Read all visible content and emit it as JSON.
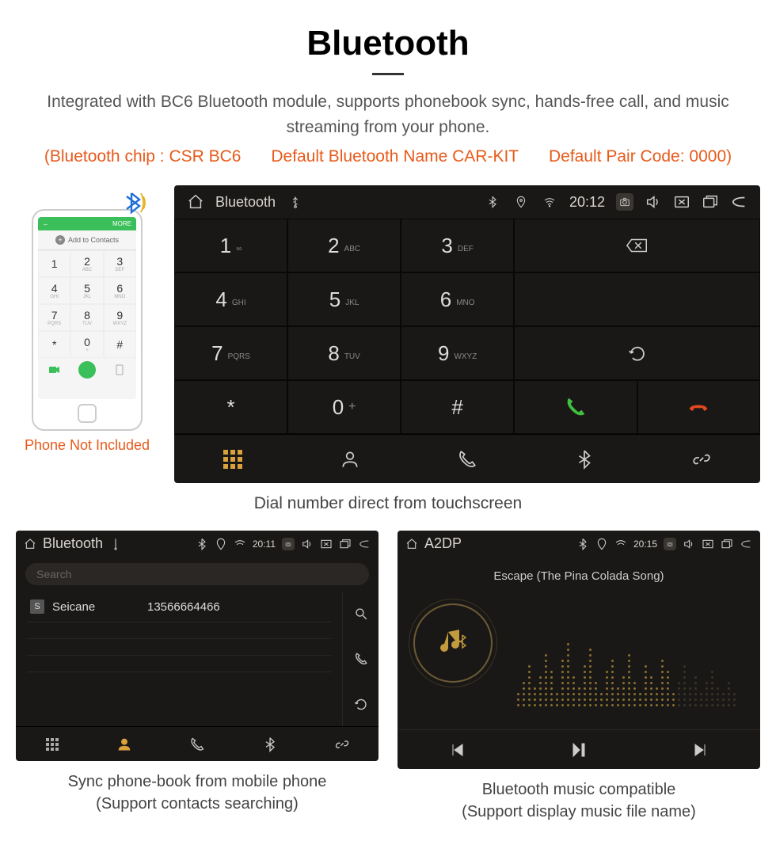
{
  "heading": "Bluetooth",
  "description": "Integrated with BC6 Bluetooth module, supports phonebook sync, hands-free call, and music streaming from your phone.",
  "spec": {
    "chip": "(Bluetooth chip : CSR BC6",
    "name": "Default Bluetooth Name CAR-KIT",
    "code": "Default Pair Code: 0000)"
  },
  "phone_not_included": "Phone Not Included",
  "phone_mock": {
    "more": "MORE",
    "add_contacts": "Add to Contacts",
    "keys": [
      {
        "n": "1",
        "l": ""
      },
      {
        "n": "2",
        "l": "ABC"
      },
      {
        "n": "3",
        "l": "DEF"
      },
      {
        "n": "4",
        "l": "GHI"
      },
      {
        "n": "5",
        "l": "JKL"
      },
      {
        "n": "6",
        "l": "MNO"
      },
      {
        "n": "7",
        "l": "PQRS"
      },
      {
        "n": "8",
        "l": "TUV"
      },
      {
        "n": "9",
        "l": "WXYZ"
      },
      {
        "n": "*",
        "l": ""
      },
      {
        "n": "0",
        "l": "+"
      },
      {
        "n": "#",
        "l": ""
      }
    ]
  },
  "dialer": {
    "status": {
      "title": "Bluetooth",
      "time": "20:12"
    },
    "keys": [
      {
        "n": "1",
        "l": "∞"
      },
      {
        "n": "2",
        "l": "ABC"
      },
      {
        "n": "3",
        "l": "DEF"
      },
      {
        "n": "4",
        "l": "GHI"
      },
      {
        "n": "5",
        "l": "JKL"
      },
      {
        "n": "6",
        "l": "MNO"
      },
      {
        "n": "7",
        "l": "PQRS"
      },
      {
        "n": "8",
        "l": "TUV"
      },
      {
        "n": "9",
        "l": "WXYZ"
      },
      {
        "n": "*",
        "l": ""
      },
      {
        "n": "0",
        "l": "+"
      },
      {
        "n": "#",
        "l": ""
      }
    ],
    "plus": "+"
  },
  "dialer_caption": "Dial number direct from touchscreen",
  "contacts": {
    "status": {
      "title": "Bluetooth",
      "time": "20:11"
    },
    "search_placeholder": "Search",
    "list": [
      {
        "badge": "S",
        "name": "Seicane",
        "number": "13566664466"
      }
    ]
  },
  "contacts_caption_1": "Sync phone-book from mobile phone",
  "contacts_caption_2": "(Support contacts searching)",
  "music": {
    "status": {
      "title": "A2DP",
      "time": "20:15"
    },
    "track": "Escape (The Pina Colada Song)"
  },
  "music_caption_1": "Bluetooth music compatible",
  "music_caption_2": "(Support display music file name)"
}
